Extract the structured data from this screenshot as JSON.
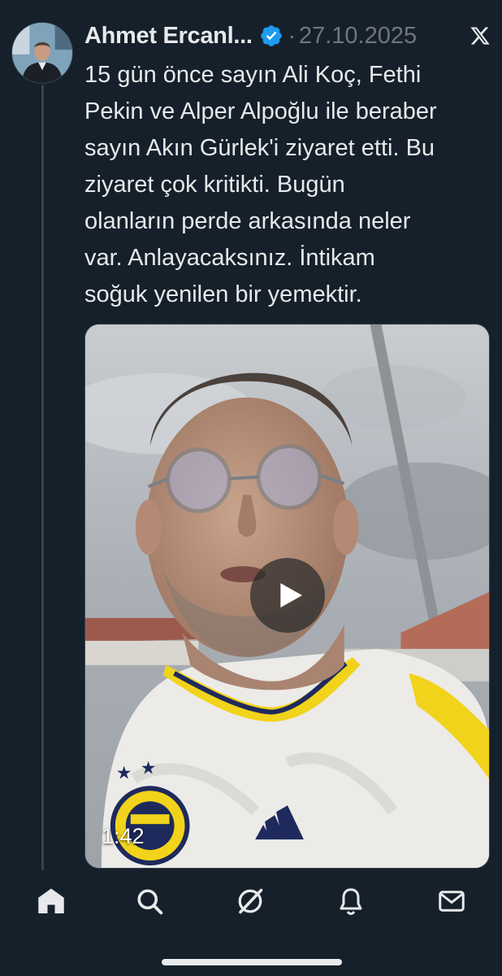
{
  "tweet": {
    "author_name": "Ahmet Ercanl...",
    "separator": "·",
    "date": "27.10.2025",
    "text": "15 gün önce sayın Ali Koç, Fethi\nPekin ve Alper Alpoğlu ile beraber\nsayın Akın Gürlek'i ziyaret etti. Bu\nziyaret çok kritikti. Bugün\nolanların perde arkasında neler\nvar. Anlayacaksınız. İntikam\nsoğuk yenilen bir yemektir.",
    "verified": true
  },
  "video": {
    "duration": "1:42",
    "state": "paused"
  },
  "bottom_nav": {
    "items": [
      {
        "icon": "home-icon",
        "active": true
      },
      {
        "icon": "search-icon",
        "active": false
      },
      {
        "icon": "grok-icon",
        "active": false
      },
      {
        "icon": "notifications-icon",
        "active": false
      },
      {
        "icon": "messages-icon",
        "active": false
      }
    ]
  },
  "colors": {
    "background": "#15202b",
    "text_primary": "#e7e9ea",
    "text_secondary": "#71767b",
    "verified_blue": "#1d9bf0"
  }
}
